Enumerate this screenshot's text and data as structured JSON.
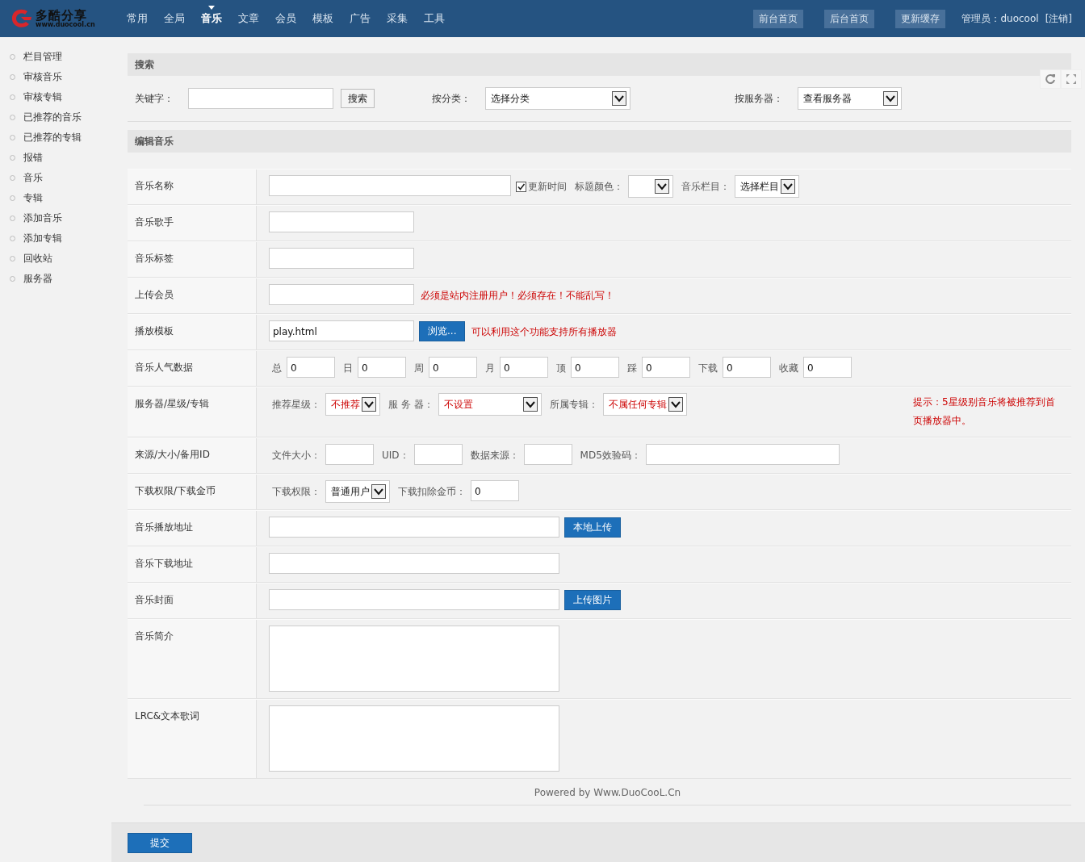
{
  "brand": {
    "name": "多酷分享",
    "url": "www.duocool.cn"
  },
  "nav": [
    {
      "label": "常用",
      "selected": false
    },
    {
      "label": "全局",
      "selected": false
    },
    {
      "label": "音乐",
      "selected": true
    },
    {
      "label": "文章",
      "selected": false
    },
    {
      "label": "会员",
      "selected": false
    },
    {
      "label": "模板",
      "selected": false
    },
    {
      "label": "广告",
      "selected": false
    },
    {
      "label": "采集",
      "selected": false
    },
    {
      "label": "工具",
      "selected": false
    }
  ],
  "header_buttons": [
    "前台首页",
    "后台首页",
    "更新缓存"
  ],
  "admin": {
    "label": "管理员：duocool",
    "logout": "[注销]"
  },
  "sidebar": {
    "items": [
      "栏目管理",
      "审核音乐",
      "审核专辑",
      "已推荐的音乐",
      "已推荐的专辑",
      "报错",
      "音乐",
      "专辑",
      "添加音乐",
      "添加专辑",
      "回收站",
      "服务器"
    ]
  },
  "search": {
    "title": "搜索",
    "keyword_label": "关键字：",
    "button": "搜索",
    "category_label": "按分类：",
    "category_value": "选择分类",
    "server_label": "按服务器：",
    "server_value": "查看服务器"
  },
  "form": {
    "title": "编辑音乐",
    "rows": [
      {
        "label": "音乐名称",
        "controls": [
          {
            "kind": "name-input"
          },
          {
            "kind": "checkbox",
            "label": "更新时间",
            "checked": true
          },
          {
            "kind": "text",
            "text": "标题颜色："
          },
          {
            "kind": "color-select"
          },
          {
            "kind": "text",
            "text": "音乐栏目："
          },
          {
            "kind": "select",
            "value": "选择栏目",
            "emphasis": false
          }
        ]
      },
      {
        "label": "音乐歌手",
        "controls": [
          {
            "kind": "input"
          }
        ]
      },
      {
        "label": "音乐标签",
        "controls": [
          {
            "kind": "input"
          }
        ]
      },
      {
        "label": "上传会员",
        "controls": [
          {
            "kind": "input"
          },
          {
            "kind": "note",
            "text": "必须是站内注册用户！必须存在！不能乱写！"
          }
        ]
      },
      {
        "label": "播放模板",
        "controls": [
          {
            "kind": "input",
            "value": "play.html"
          },
          {
            "kind": "button",
            "text": "浏览..."
          },
          {
            "kind": "note",
            "text": "可以利用这个功能支持所有播放器"
          }
        ]
      },
      {
        "label": "音乐人气数据",
        "controls": [
          {
            "kind": "text",
            "text": "总"
          },
          {
            "kind": "small-input",
            "value": "0"
          },
          {
            "kind": "text",
            "text": "日"
          },
          {
            "kind": "small-input",
            "value": "0"
          },
          {
            "kind": "text",
            "text": "周"
          },
          {
            "kind": "small-input",
            "value": "0"
          },
          {
            "kind": "text",
            "text": "月"
          },
          {
            "kind": "small-input",
            "value": "0"
          },
          {
            "kind": "text",
            "text": "顶"
          },
          {
            "kind": "small-input",
            "value": "0"
          },
          {
            "kind": "text",
            "text": "踩"
          },
          {
            "kind": "small-input",
            "value": "0"
          },
          {
            "kind": "text",
            "text": "下载"
          },
          {
            "kind": "small-input",
            "value": "0"
          },
          {
            "kind": "text",
            "text": "收藏"
          },
          {
            "kind": "small-input",
            "value": "0"
          }
        ]
      },
      {
        "label": "服务器/星级/专辑",
        "controls": [
          {
            "kind": "text",
            "text": "推荐星级："
          },
          {
            "kind": "select",
            "value": "不推荐",
            "emphasis": true
          },
          {
            "kind": "text",
            "text": "服 务 器："
          },
          {
            "kind": "wide-select",
            "value": "不设置",
            "emphasis": true
          },
          {
            "kind": "text",
            "text": "所属专辑："
          },
          {
            "kind": "select",
            "value": "不属任何专辑",
            "emphasis": true
          },
          {
            "kind": "tip",
            "text": "提示：5星级别音乐将被推荐到首页播放器中。"
          }
        ]
      },
      {
        "label": "来源/大小/备用ID",
        "controls": [
          {
            "kind": "text",
            "text": "文件大小："
          },
          {
            "kind": "tiny-input"
          },
          {
            "kind": "text",
            "text": "UID："
          },
          {
            "kind": "tiny-input"
          },
          {
            "kind": "text",
            "text": "数据来源："
          },
          {
            "kind": "tiny-input"
          },
          {
            "kind": "text",
            "text": "MD5效验码："
          },
          {
            "kind": "md5-input"
          }
        ]
      },
      {
        "label": "下载权限/下载金币",
        "controls": [
          {
            "kind": "text",
            "text": "下载权限："
          },
          {
            "kind": "select",
            "value": "普通用户",
            "emphasis": false
          },
          {
            "kind": "text",
            "text": "下载扣除金币："
          },
          {
            "kind": "tiny-input",
            "value": "0"
          }
        ]
      },
      {
        "label": "音乐播放地址",
        "controls": [
          {
            "kind": "long-input"
          },
          {
            "kind": "button",
            "text": "本地上传"
          }
        ]
      },
      {
        "label": "音乐下载地址",
        "controls": [
          {
            "kind": "long-input"
          }
        ]
      },
      {
        "label": "音乐封面",
        "controls": [
          {
            "kind": "long-input"
          },
          {
            "kind": "button",
            "text": "上传图片"
          }
        ]
      },
      {
        "label": "音乐简介",
        "controls": [
          {
            "kind": "textarea"
          }
        ]
      },
      {
        "label": "LRC&文本歌词",
        "controls": [
          {
            "kind": "textarea"
          }
        ]
      }
    ]
  },
  "footer": "Powered by Www.DuoCooL.Cn",
  "submit": "提交"
}
